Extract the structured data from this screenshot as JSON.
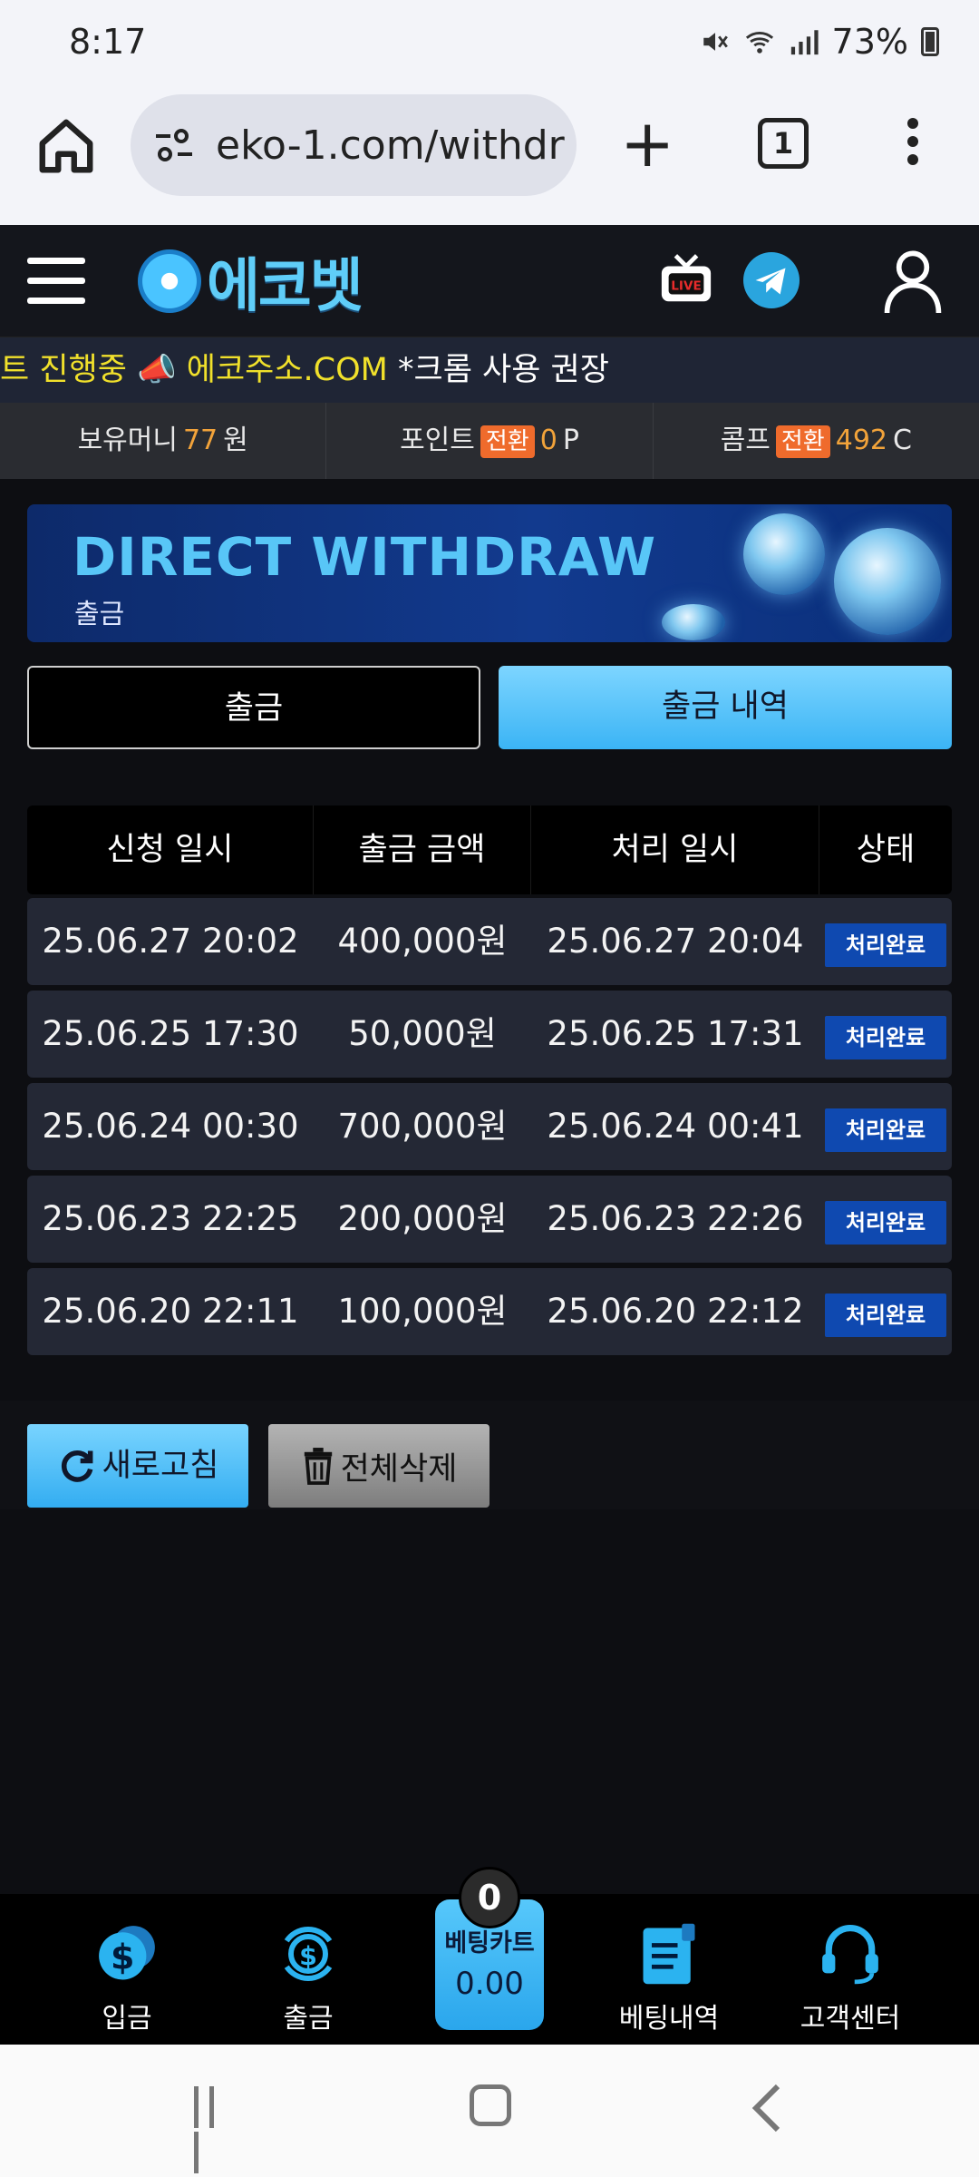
{
  "status_bar": {
    "time": "8:17",
    "battery": "73%"
  },
  "browser": {
    "url": "eko-1.com/withdr",
    "tab_count": "1"
  },
  "site": {
    "logo_text": "에코벳",
    "marquee": {
      "part1": "트 진행중 📣 에코주소.COM",
      "part2": " *크롬 사용 권장"
    },
    "balances": [
      {
        "label": "보유머니",
        "value": "77",
        "unit": "원",
        "tag": ""
      },
      {
        "label": "포인트",
        "value": "0",
        "unit": "P",
        "tag": "전환"
      },
      {
        "label": "콤프",
        "value": "492",
        "unit": "C",
        "tag": "전환"
      }
    ]
  },
  "banner": {
    "title": "DIRECT WITHDRAW",
    "subtitle": "출금"
  },
  "tabs": {
    "withdraw": "출금",
    "history": "출금 내역"
  },
  "table": {
    "headers": [
      "신청 일시",
      "출금 금액",
      "처리 일시",
      "상태"
    ],
    "rows": [
      {
        "requested": "25.06.27 20:02",
        "amount": "400,000원",
        "processed": "25.06.27 20:04",
        "status": "처리완료"
      },
      {
        "requested": "25.06.25 17:30",
        "amount": "50,000원",
        "processed": "25.06.25 17:31",
        "status": "처리완료"
      },
      {
        "requested": "25.06.24 00:30",
        "amount": "700,000원",
        "processed": "25.06.24 00:41",
        "status": "처리완료"
      },
      {
        "requested": "25.06.23 22:25",
        "amount": "200,000원",
        "processed": "25.06.23 22:26",
        "status": "처리완료"
      },
      {
        "requested": "25.06.20 22:11",
        "amount": "100,000원",
        "processed": "25.06.20 22:12",
        "status": "처리완료"
      }
    ]
  },
  "actions": {
    "refresh": "새로고침",
    "delete_all": "전체삭제"
  },
  "bottom_nav": {
    "deposit": "입금",
    "withdraw": "출금",
    "cart_label": "베팅카트",
    "cart_value": "0.00",
    "cart_count": "0",
    "bet_history": "베팅내역",
    "support": "고객센터"
  },
  "colors": {
    "accent": "#3bb4f5",
    "highlight": "#f2a33a",
    "badge": "#0f49b0",
    "marquee_text": "#f0e02b"
  }
}
